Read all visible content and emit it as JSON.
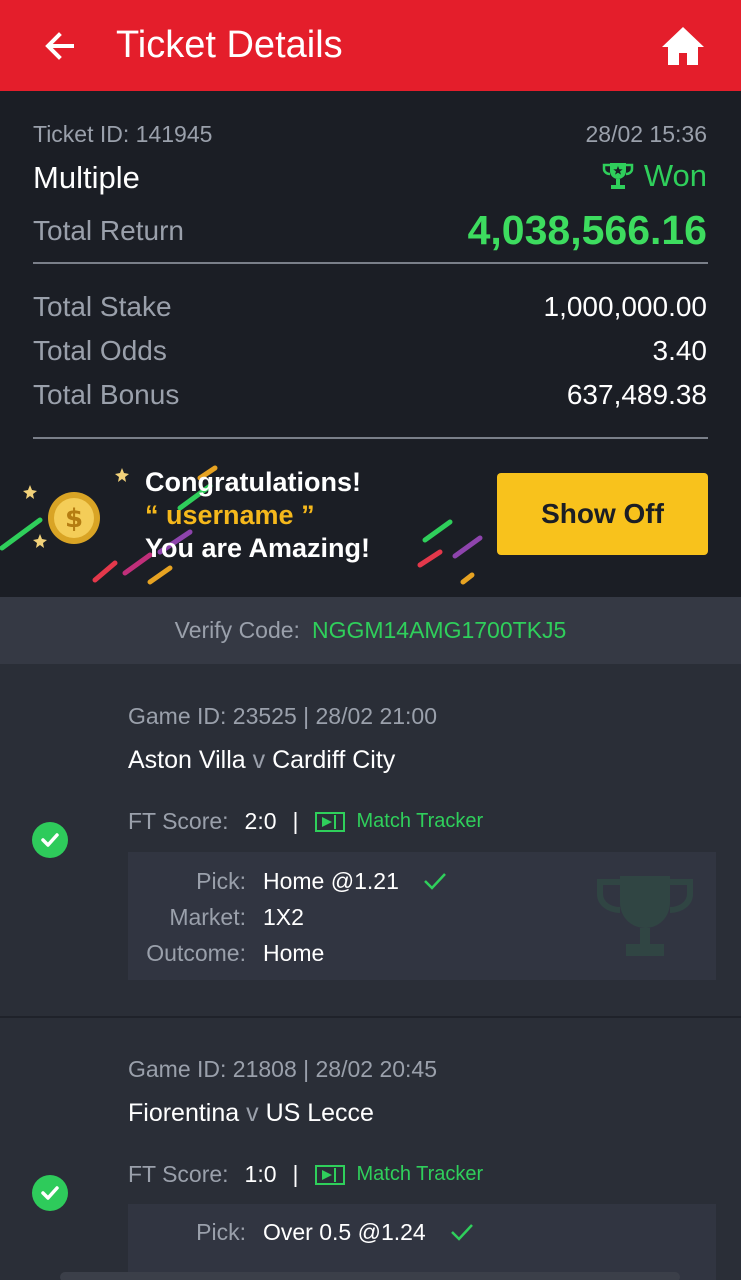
{
  "header": {
    "title": "Ticket Details",
    "back_icon": "arrow-left-icon",
    "home_icon": "home-icon",
    "color": "#e41e2b"
  },
  "ticket": {
    "id_text": "Ticket ID: 141945",
    "datetime": "28/02 15:36",
    "type": "Multiple",
    "status": "Won",
    "total_return_label": "Total Return",
    "total_return": "4,038,566.16",
    "total_stake_label": "Total Stake",
    "total_stake": "1,000,000.00",
    "total_odds_label": "Total Odds",
    "total_odds": "3.40",
    "total_bonus_label": "Total Bonus",
    "total_bonus": "637,489.38"
  },
  "banner": {
    "line1": "Congratulations!",
    "line2": "“ username ”",
    "line3": "You are Amazing!",
    "button": "Show Off",
    "coin_icon": "dollar-coin-icon"
  },
  "verify": {
    "label": "Verify Code:",
    "code": "NGGM14AMG1700TKJ5"
  },
  "games": [
    {
      "id_line": "Game ID: 23525 | 28/02 21:00",
      "home": "Aston Villa",
      "vs": "v",
      "away": "Cardiff City",
      "score_label": "FT Score:",
      "score": "2:0",
      "tracker": "Match Tracker",
      "pick_label": "Pick:",
      "pick": "Home @1.21",
      "market_label": "Market:",
      "market": "1X2",
      "outcome_label": "Outcome:",
      "outcome": "Home"
    },
    {
      "id_line": "Game ID: 21808 | 28/02 20:45",
      "home": "Fiorentina",
      "vs": "v",
      "away": "US Lecce",
      "score_label": "FT Score:",
      "score": "1:0",
      "tracker": "Match Tracker",
      "pick_label": "Pick:",
      "pick": "Over 0.5 @1.24"
    }
  ],
  "colors": {
    "won_green": "#2fcf5b",
    "return_green": "#3ddc5f",
    "button_yellow": "#f8c21c",
    "panel_dark": "#1b1e25"
  }
}
